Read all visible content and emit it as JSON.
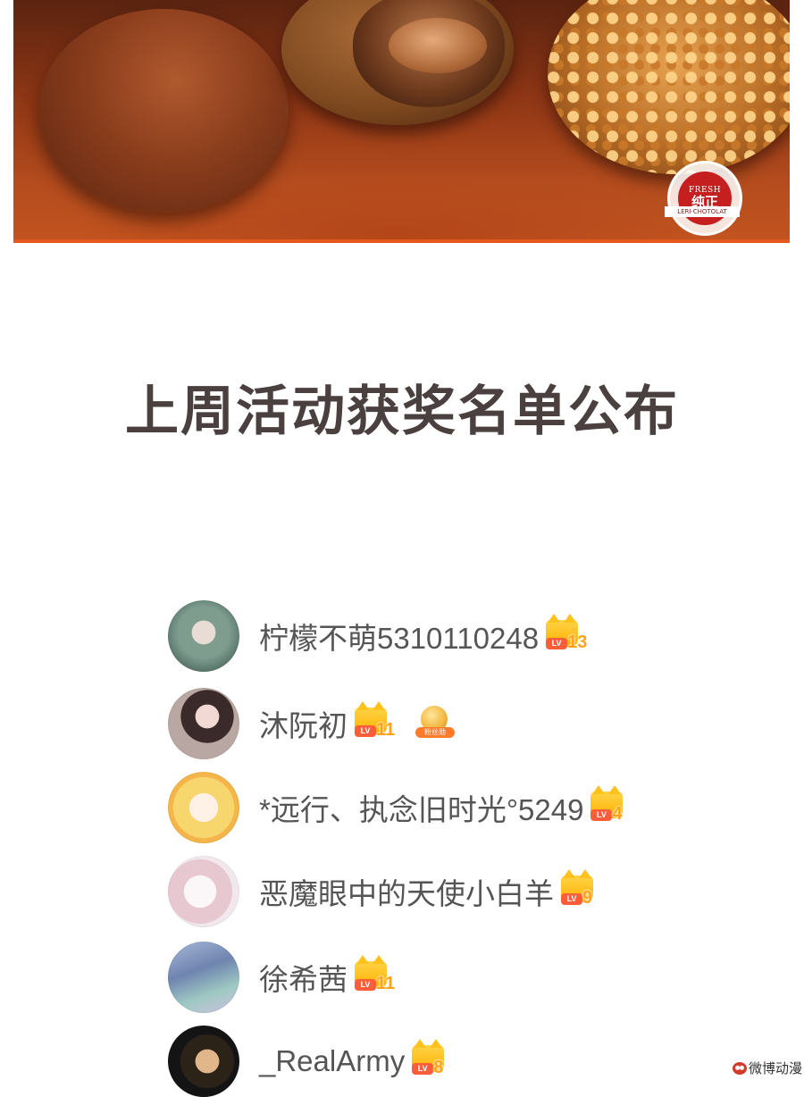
{
  "banner": {
    "seal_top_text": "FRESH",
    "seal_main_text": "纯正",
    "seal_ribbon_text": "LERI·CHOTOLAT"
  },
  "heading": "上周活动获奖名单公布",
  "winners": [
    {
      "name": "柠檬不萌5310110248",
      "level": "13",
      "level_tag": "LV"
    },
    {
      "name": "沐阮初",
      "level": "11",
      "level_tag": "LV",
      "medal_label": "粉丝勋"
    },
    {
      "name": "*远行、执念旧时光°5249",
      "level": "4",
      "level_tag": "LV"
    },
    {
      "name": "恶魔眼中的天使小白羊",
      "level": "9",
      "level_tag": "LV"
    },
    {
      "name": "徐希茜",
      "level": "11",
      "level_tag": "LV"
    },
    {
      "name": "_RealArmy",
      "level": "8",
      "level_tag": "LV"
    }
  ],
  "watermark": "微博动漫",
  "colors": {
    "heading": "#4a4040",
    "name_text": "#555555",
    "level_number": "#ffa21a",
    "level_tag_bg": "#ff5d3a",
    "banner_accent": "#e35a1c"
  },
  "icons": {
    "level_badge": "cat-level-badge-icon",
    "medal": "medal-icon",
    "watermark": "weibo-logo-icon"
  }
}
